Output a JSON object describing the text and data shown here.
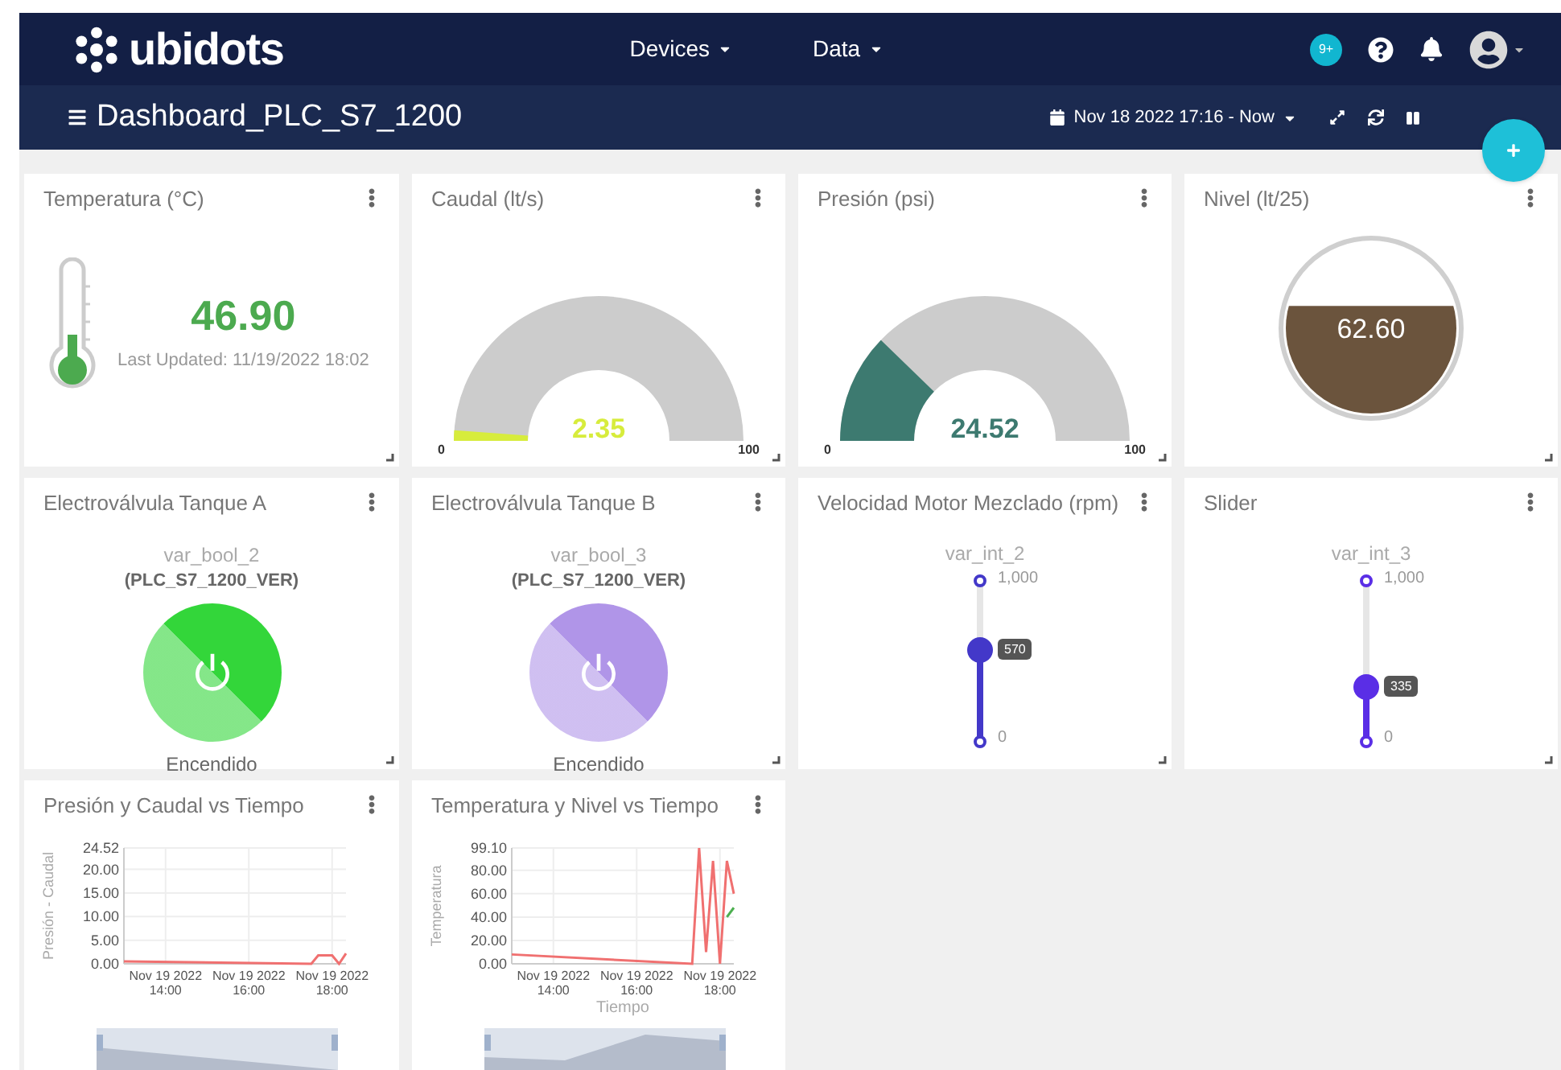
{
  "navbar": {
    "logo": "ubidots",
    "menus": [
      {
        "label": "Devices"
      },
      {
        "label": "Data"
      }
    ],
    "notification_badge": "9+"
  },
  "header": {
    "title": "Dashboard_PLC_S7_1200",
    "date_range": "Nov 18 2022 17:16 - Now"
  },
  "widgets": [
    {
      "kind": "thermometer",
      "title": "Temperatura (°C)",
      "value": "46.90",
      "caption": "Last Updated: 11/19/2022 18:02",
      "color": "#4caa4f"
    },
    {
      "kind": "gauge",
      "title": "Caudal (lt/s)",
      "value": "2.35",
      "min": "0",
      "max": "100",
      "color": "#d7ec3c"
    },
    {
      "kind": "gauge",
      "title": "Presión (psi)",
      "value": "24.52",
      "min": "0",
      "max": "100",
      "color": "#3d7a70"
    },
    {
      "kind": "tank",
      "title": "Nivel (lt/25)",
      "value": "62.60",
      "color": "#6b543d"
    },
    {
      "kind": "switch",
      "title": "Electroválvula Tanque A",
      "variable": "var_bool_2",
      "device": "(PLC_S7_1200_VER)",
      "on": true,
      "status": "Encendido",
      "color": "#33d63a"
    },
    {
      "kind": "switch",
      "title": "Electroválvula Tanque B",
      "variable": "var_bool_3",
      "device": "(PLC_S7_1200_VER)",
      "on": true,
      "status": "Encendido",
      "color": "#b095e8"
    },
    {
      "kind": "slider",
      "title": "Velocidad Motor Mezclado (rpm)",
      "variable": "var_int_2",
      "max": "1,000",
      "min": "0",
      "value": "570",
      "level": 0.57,
      "color": "#4338c9"
    },
    {
      "kind": "slider",
      "title": "Slider",
      "variable": "var_int_3",
      "max": "1,000",
      "min": "0",
      "value": "335",
      "level": 0.335,
      "color": "#5a2ee6"
    },
    {
      "kind": "chart",
      "title": "Presión y Caudal vs Tiempo",
      "chart_data": {
        "type": "line",
        "ylabel": "Presión - Caudal",
        "categories": [
          null,
          null,
          null,
          null,
          null,
          null,
          "Nov 19 2022 14:00",
          null,
          null,
          null,
          null,
          null,
          null,
          null,
          null,
          null,
          null,
          null,
          "Nov 19 2022 16:00",
          null,
          null,
          null,
          null,
          null,
          null,
          null,
          null,
          null,
          null,
          null,
          "Nov 19 2022 18:00",
          null,
          null
        ],
        "series": [
          {
            "color": "#f07070",
            "values": [
              0.5,
              null,
              null,
              null,
              null,
              null,
              null,
              null,
              null,
              null,
              null,
              null,
              null,
              null,
              null,
              null,
              null,
              null,
              null,
              null,
              null,
              null,
              null,
              null,
              null,
              null,
              null,
              0,
              1.8,
              1.8,
              1.8,
              0,
              2.2
            ]
          }
        ],
        "ylim": [
          0,
          24.52
        ],
        "grid": true,
        "yticks": [
          {
            "value": 0,
            "label": "0.00"
          },
          {
            "value": 5,
            "label": "5.00"
          },
          {
            "value": 10,
            "label": "10.00"
          },
          {
            "value": 15,
            "label": "15.00"
          },
          {
            "value": 20,
            "label": "20.00"
          },
          {
            "value": 24.52,
            "label": "24.52"
          }
        ]
      }
    },
    {
      "kind": "chart",
      "title": "Temperatura y Nivel vs Tiempo",
      "chart_data": {
        "type": "line",
        "ylabel": "Temperatura",
        "xlabel": "Tiempo",
        "categories": [
          null,
          null,
          null,
          null,
          null,
          null,
          "Nov 19 2022 14:00",
          null,
          null,
          null,
          null,
          null,
          null,
          null,
          null,
          null,
          null,
          null,
          "Nov 19 2022 16:00",
          null,
          null,
          null,
          null,
          null,
          null,
          null,
          null,
          null,
          null,
          null,
          "Nov 19 2022 18:00",
          null,
          null
        ],
        "series": [
          {
            "color": "#f07070",
            "values": [
              8,
              null,
              null,
              null,
              null,
              null,
              null,
              null,
              null,
              null,
              null,
              null,
              null,
              null,
              null,
              null,
              null,
              null,
              null,
              null,
              null,
              null,
              null,
              null,
              null,
              null,
              0,
              99,
              10,
              88,
              0,
              88,
              60
            ]
          },
          {
            "color": "#4caf50",
            "values": [
              null,
              null,
              null,
              null,
              null,
              null,
              null,
              null,
              null,
              null,
              null,
              null,
              null,
              null,
              null,
              null,
              null,
              null,
              null,
              null,
              null,
              null,
              null,
              null,
              null,
              null,
              null,
              null,
              null,
              null,
              null,
              40,
              48
            ]
          }
        ],
        "ylim": [
          0,
          99.1
        ],
        "grid": true,
        "yticks": [
          {
            "value": 0,
            "label": "0.00"
          },
          {
            "value": 20,
            "label": "20.00"
          },
          {
            "value": 40,
            "label": "40.00"
          },
          {
            "value": 60,
            "label": "60.00"
          },
          {
            "value": 80,
            "label": "80.00"
          },
          {
            "value": 99.1,
            "label": "99.10"
          }
        ]
      }
    }
  ]
}
